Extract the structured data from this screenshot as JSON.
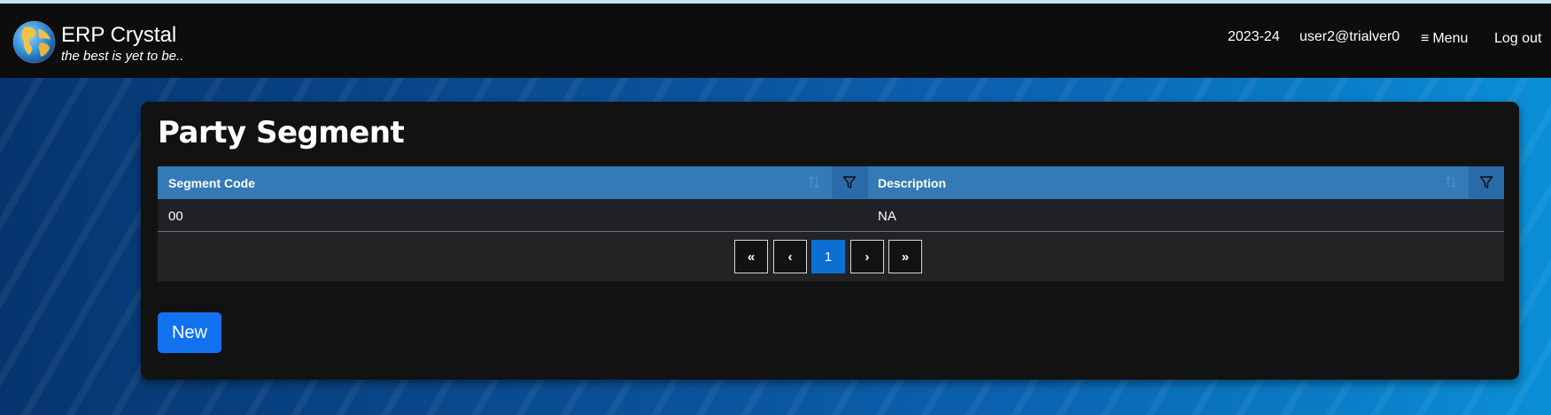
{
  "brand": {
    "title": "ERP Crystal",
    "tagline": "the best is yet to be.."
  },
  "nav": {
    "year": "2023-24",
    "user": "user2@trialver0",
    "menu_label": "Menu",
    "logout_label": "Log out"
  },
  "page": {
    "title": "Party Segment"
  },
  "grid": {
    "columns": [
      {
        "label": "Segment Code"
      },
      {
        "label": "Description"
      }
    ],
    "rows": [
      {
        "segment_code": "00",
        "description": "NA"
      }
    ],
    "pager": {
      "first": "«",
      "prev": "‹",
      "current": "1",
      "next": "›",
      "last": "»"
    }
  },
  "actions": {
    "new_label": "New"
  },
  "icons": {
    "logo": "globe-icon",
    "menu": "hamburger-icon",
    "sort": "sort-icon",
    "filter": "filter-icon"
  },
  "colors": {
    "navbar": "#0d0d0e",
    "header": "#337ab7",
    "active_page": "#0b6fd4",
    "primary_button": "#1271ef"
  }
}
